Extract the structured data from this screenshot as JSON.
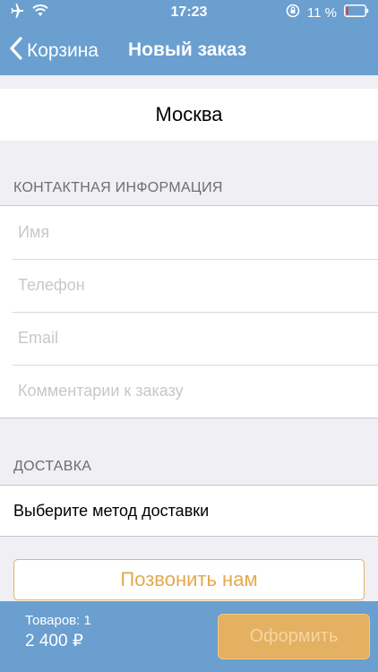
{
  "status_bar": {
    "time": "17:23",
    "battery_percent": "11 %",
    "battery_level": 0.11,
    "icons": [
      "airplane-icon",
      "wifi-icon",
      "rotation-lock-icon",
      "battery-icon"
    ]
  },
  "navbar": {
    "back_label": "Корзина",
    "title": "Новый заказ"
  },
  "city": "Москва",
  "contact": {
    "header": "КОНТАКТНАЯ ИНФОРМАЦИЯ",
    "fields": [
      {
        "placeholder": "Имя",
        "value": ""
      },
      {
        "placeholder": "Телефон",
        "value": ""
      },
      {
        "placeholder": "Email",
        "value": ""
      },
      {
        "placeholder": "Комментарии к заказу",
        "value": ""
      }
    ]
  },
  "delivery": {
    "header": "ДОСТАВКА",
    "select_label": "Выберите метод доставки"
  },
  "call_button_label": "Позвонить нам",
  "bottom": {
    "items_count": "Товаров: 1",
    "total": "2 400 ₽",
    "order_button_label": "Оформить"
  },
  "colors": {
    "bar_blue": "#6a9fd0",
    "accent_orange": "#e3a94e",
    "background": "#efeff4",
    "battery_low_red": "#e53935"
  }
}
